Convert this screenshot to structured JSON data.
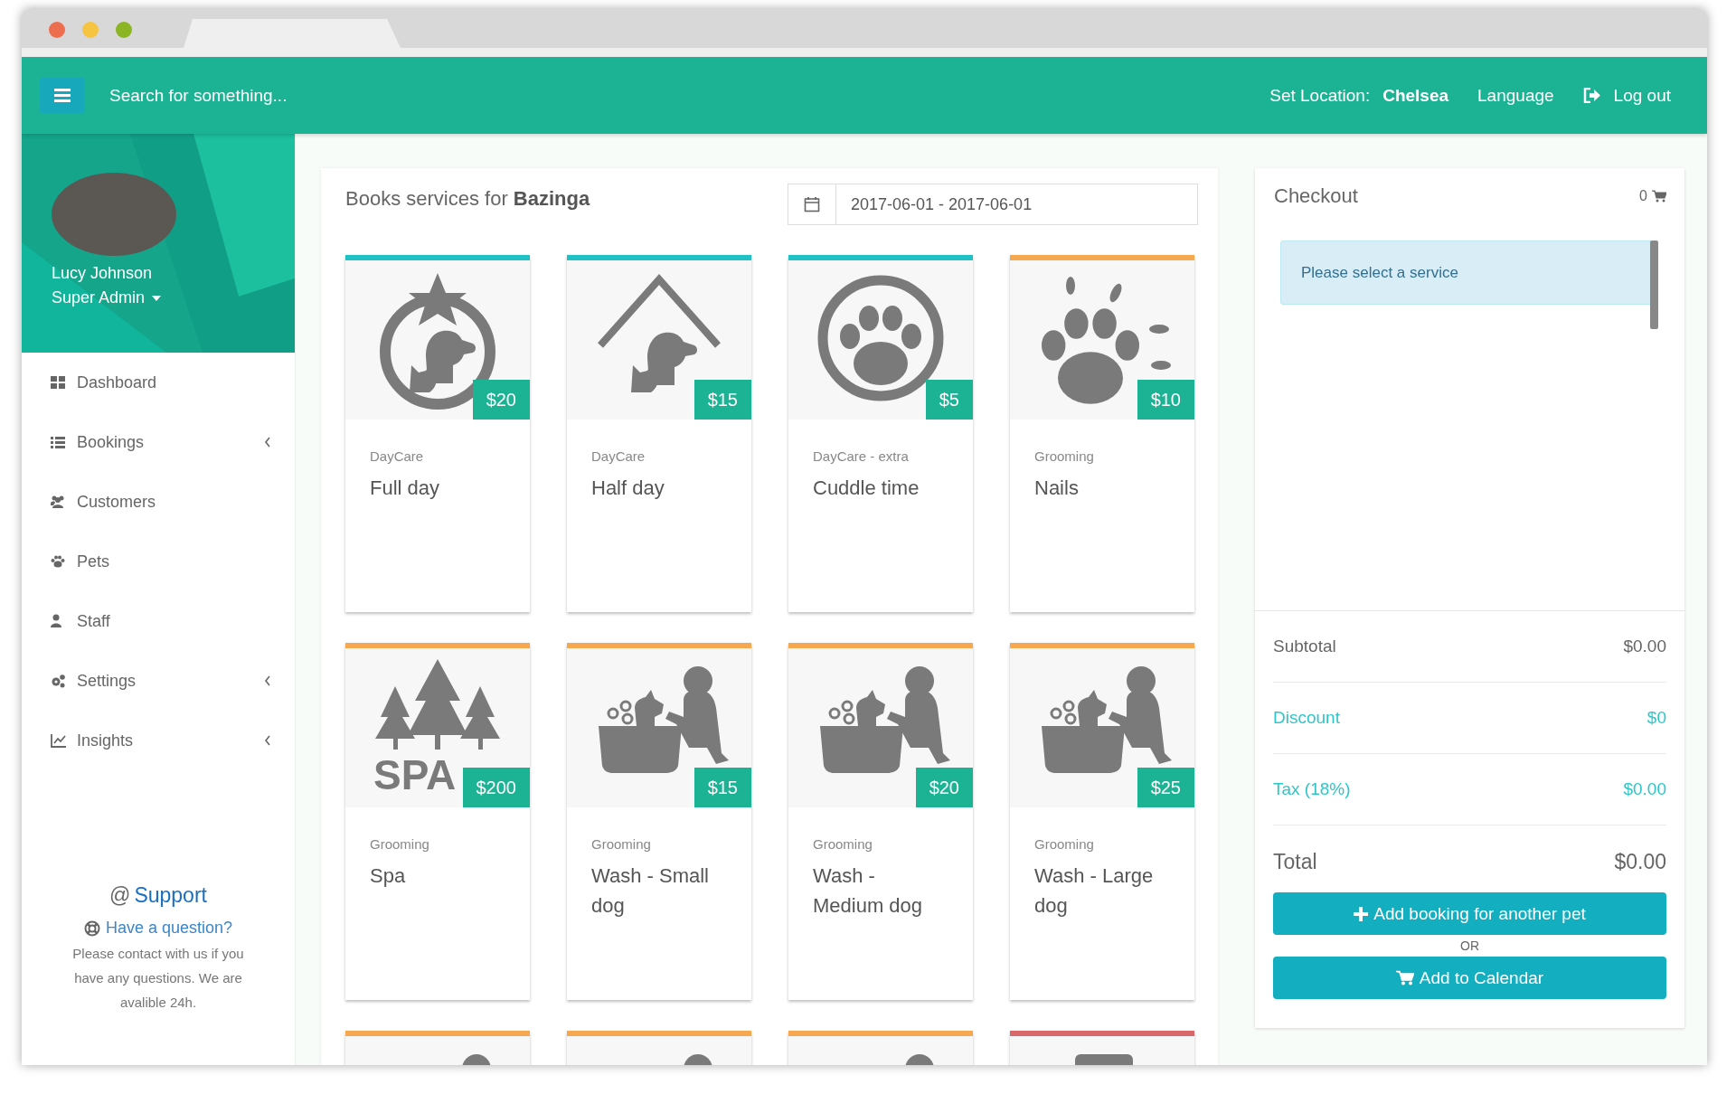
{
  "header": {
    "search_placeholder": "Search for something...",
    "location": "Set Location: **Chelsea**",
    "language": "Language",
    "logout": "Log out"
  },
  "profile": {
    "name": "Lucy Johnson",
    "role": "Super Admin"
  },
  "sidebar": {
    "items": [
      {
        "label": "Dashboard",
        "has_submenu": false
      },
      {
        "label": "Bookings",
        "has_submenu": true
      },
      {
        "label": "Customers",
        "has_submenu": false
      },
      {
        "label": "Pets",
        "has_submenu": false
      },
      {
        "label": "Staff",
        "has_submenu": false
      },
      {
        "label": "Settings",
        "has_submenu": true
      },
      {
        "label": "Insights",
        "has_submenu": true
      }
    ],
    "support": {
      "symbol": "@",
      "title": "Support",
      "question": "Have a question?",
      "text": "Please contact with us if you have any questions. We are avalible 24h."
    }
  },
  "services": {
    "title": "Books services for **Bazinga**",
    "date_range": "2017-06-01 - 2017-06-01",
    "cards": [
      {
        "color": "#1fc1c4",
        "price": "$20",
        "category": "DayCare",
        "title": "Full day"
      },
      {
        "color": "#1fc1c4",
        "price": "$15",
        "category": "DayCare",
        "title": "Half day"
      },
      {
        "color": "#1fc1c4",
        "price": "$5",
        "category": "DayCare - extra",
        "title": "Cuddle time"
      },
      {
        "color": "#f5a850",
        "price": "$10",
        "category": "Grooming",
        "title": "Nails"
      },
      {
        "color": "#f5a850",
        "price": "$200",
        "category": "Grooming",
        "title": "Spa",
        "icon_text": "SPA"
      },
      {
        "color": "#f5a850",
        "price": "$15",
        "category": "Grooming",
        "title": "Wash - Small dog"
      },
      {
        "color": "#f5a850",
        "price": "$20",
        "category": "Grooming",
        "title": "Wash - Medium dog"
      },
      {
        "color": "#f5a850",
        "price": "$25",
        "category": "Grooming",
        "title": "Wash - Large dog"
      },
      {
        "color": "#f5a850"
      },
      {
        "color": "#f5a850"
      },
      {
        "color": "#f5a850"
      },
      {
        "color": "#d9686b"
      }
    ]
  },
  "checkout": {
    "title": "Checkout",
    "cart_count": "0",
    "empty_message": "Please select a service",
    "rows": [
      {
        "kind": "plain",
        "label": "Subtotal",
        "value": "$0.00"
      },
      {
        "kind": "adjustment",
        "label": "Discount",
        "value": "$0"
      },
      {
        "kind": "adjustment",
        "label": "Tax (18%)",
        "value": "$0.00"
      },
      {
        "kind": "total",
        "label": "Total",
        "value": "$0.00"
      }
    ],
    "add_button": "Add booking for another pet",
    "separator": "OR",
    "calendar_button": "Add to Calendar"
  }
}
